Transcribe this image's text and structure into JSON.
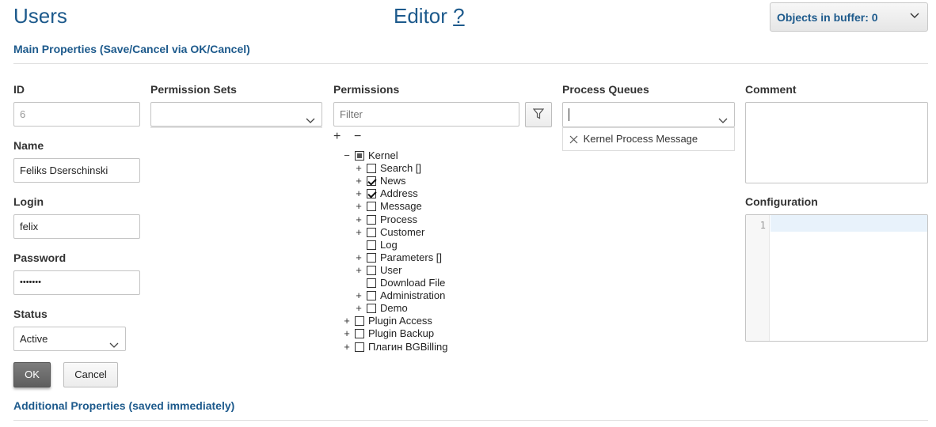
{
  "header": {
    "title": "Users",
    "editor_title": "Editor",
    "help_link": "?",
    "buffer_label": "Objects in buffer: 0"
  },
  "sections": {
    "main": "Main Properties (Save/Cancel via OK/Cancel)",
    "additional": "Additional Properties (saved immediately)"
  },
  "form": {
    "id_label": "ID",
    "id_value": "6",
    "name_label": "Name",
    "name_value": "Feliks Dserschinski",
    "login_label": "Login",
    "login_value": "felix",
    "password_label": "Password",
    "password_value": "•••••••",
    "status_label": "Status",
    "status_value": "Active",
    "ok_label": "OK",
    "cancel_label": "Cancel"
  },
  "permission_sets": {
    "label": "Permission Sets",
    "value": ""
  },
  "permissions": {
    "label": "Permissions",
    "filter_placeholder": "Filter",
    "expand_all": "+",
    "collapse_all": "−",
    "tree": [
      {
        "exp": "−",
        "label": "Kernel",
        "state": "partial",
        "level": 0
      },
      {
        "exp": "+",
        "label": "Search []",
        "state": "unchecked",
        "level": 1
      },
      {
        "exp": "+",
        "label": "News",
        "state": "checked",
        "level": 1
      },
      {
        "exp": "+",
        "label": "Address",
        "state": "checked",
        "level": 1
      },
      {
        "exp": "+",
        "label": "Message",
        "state": "unchecked",
        "level": 1
      },
      {
        "exp": "+",
        "label": "Process",
        "state": "unchecked",
        "level": 1
      },
      {
        "exp": "+",
        "label": "Customer",
        "state": "unchecked",
        "level": 1
      },
      {
        "exp": "",
        "label": "Log",
        "state": "unchecked",
        "level": 1
      },
      {
        "exp": "+",
        "label": "Parameters []",
        "state": "unchecked",
        "level": 1
      },
      {
        "exp": "+",
        "label": "User",
        "state": "unchecked",
        "level": 1
      },
      {
        "exp": "",
        "label": "Download File",
        "state": "unchecked",
        "level": 1
      },
      {
        "exp": "+",
        "label": "Administration",
        "state": "unchecked",
        "level": 1
      },
      {
        "exp": "+",
        "label": "Demo",
        "state": "unchecked",
        "level": 1
      },
      {
        "exp": "+",
        "label": "Plugin Access",
        "state": "unchecked",
        "level": 0
      },
      {
        "exp": "+",
        "label": "Plugin Backup",
        "state": "unchecked",
        "level": 0
      },
      {
        "exp": "+",
        "label": "Плагин BGBilling",
        "state": "unchecked",
        "level": 0
      }
    ]
  },
  "process_queues": {
    "label": "Process Queues",
    "value": "",
    "selected": [
      {
        "remove": "×",
        "label": "Kernel Process Message"
      }
    ]
  },
  "comment": {
    "label": "Comment",
    "value": ""
  },
  "configuration": {
    "label": "Configuration",
    "line_number": "1"
  },
  "icons": {
    "chevron": "chevron-down-icon",
    "filter": "filter-icon",
    "remove": "close-icon"
  }
}
